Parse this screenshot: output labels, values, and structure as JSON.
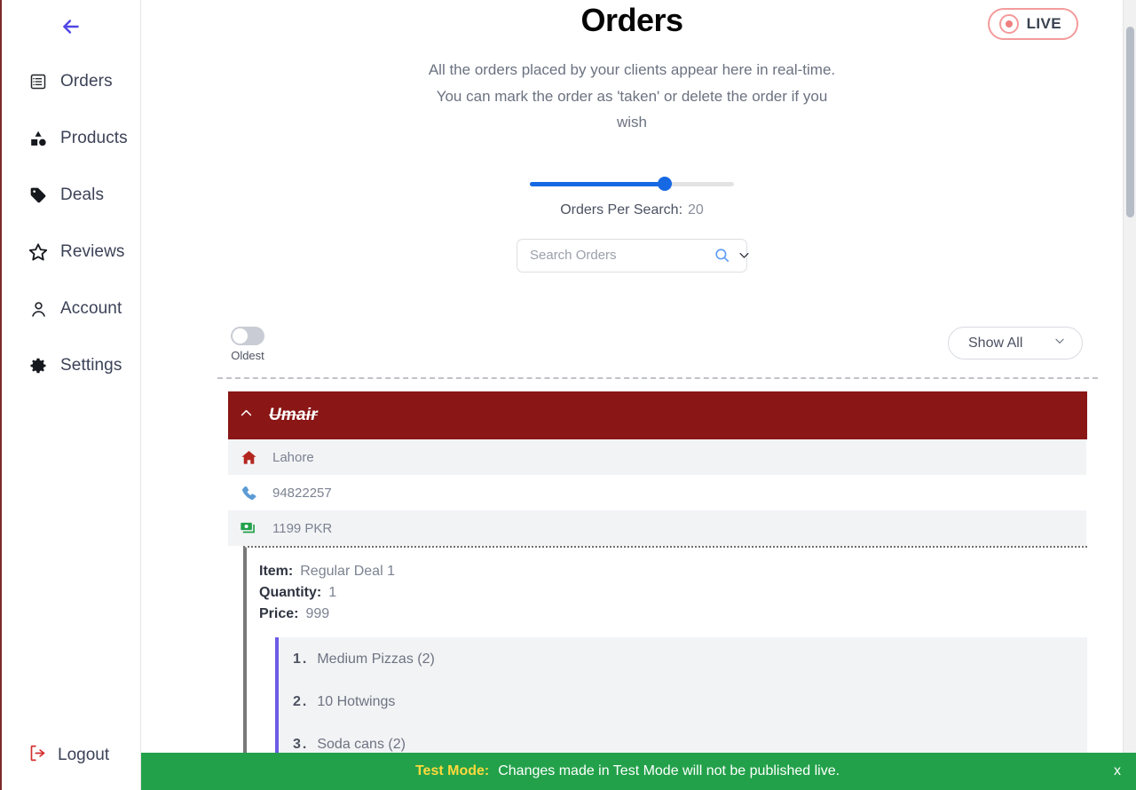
{
  "sidebar": {
    "back_icon": "arrow-left-icon",
    "items": [
      {
        "label": "Orders",
        "icon": "list-box-icon"
      },
      {
        "label": "Products",
        "icon": "shapes-icon"
      },
      {
        "label": "Deals",
        "icon": "tag-icon"
      },
      {
        "label": "Reviews",
        "icon": "star-icon"
      },
      {
        "label": "Account",
        "icon": "person-icon"
      },
      {
        "label": "Settings",
        "icon": "gear-icon"
      }
    ],
    "logout": {
      "label": "Logout",
      "icon": "logout-icon"
    }
  },
  "header": {
    "title": "Orders",
    "subtitle": "All the orders placed by your clients appear here in real-time. You can mark the order as 'taken' or delete the order if you wish",
    "live_badge": {
      "label": "LIVE",
      "icon": "record-dot-icon",
      "color": "#f49b9b"
    }
  },
  "slider": {
    "label": "Orders Per Search:",
    "value": "20",
    "fill_percent": 66,
    "color": "#1668e3"
  },
  "search": {
    "placeholder": "Search Orders",
    "value": "",
    "search_icon": "search-icon",
    "chevron_icon": "chevron-down-icon"
  },
  "toolbar": {
    "toggle": {
      "label": "Oldest",
      "state": "off"
    },
    "filter": {
      "label": "Show All",
      "chevron_icon": "chevron-down-icon"
    }
  },
  "order": {
    "collapse_icon": "chevron-up-icon",
    "customer_name": "Umair",
    "header_color": "#8a1616",
    "rows": [
      {
        "icon": "home-icon",
        "text": "Lahore",
        "icon_color": "#b3261e"
      },
      {
        "icon": "phone-icon",
        "text": "94822257",
        "icon_color": "#5b9bd5"
      },
      {
        "icon": "money-icon",
        "text": "1199 PKR",
        "icon_color": "#22a14a"
      }
    ],
    "item": {
      "item_label": "Item:",
      "item_value": "Regular Deal 1",
      "quantity_label": "Quantity:",
      "quantity_value": "1",
      "price_label": "Price:",
      "price_value": "999"
    },
    "sub_items": [
      {
        "num": "1.",
        "text": "Medium Pizzas (2)"
      },
      {
        "num": "2.",
        "text": "10 Hotwings"
      },
      {
        "num": "3.",
        "text": "Soda cans (2)"
      }
    ]
  },
  "test_banner": {
    "label": "Test Mode:",
    "message": "Changes made in Test Mode will not be published live.",
    "close": "x",
    "background": "#22a14a",
    "label_color": "#ffd93d"
  }
}
